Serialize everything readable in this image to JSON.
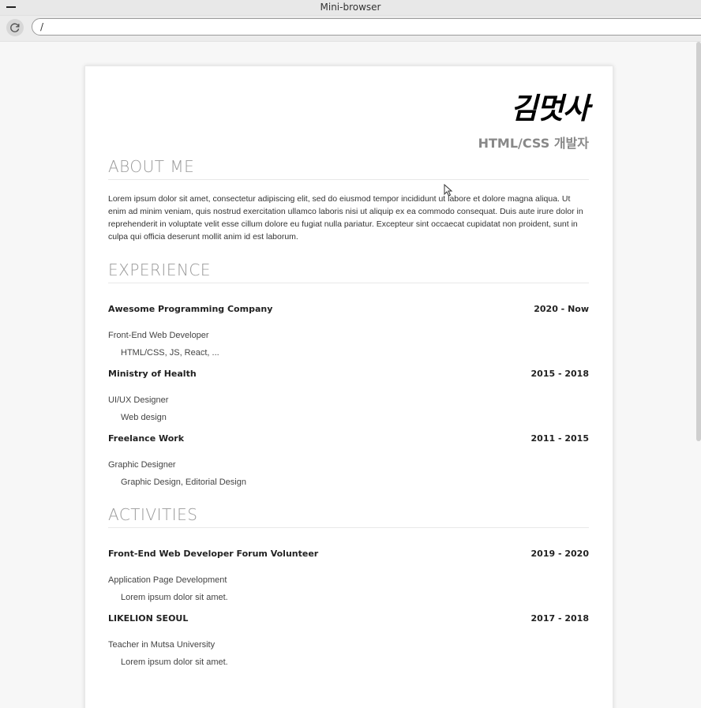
{
  "window": {
    "title": "Mini-browser"
  },
  "toolbar": {
    "address": "/"
  },
  "resume": {
    "name": "김멋사",
    "subtitle": "HTML/CSS 개발자",
    "about": {
      "title": "ABOUT ME",
      "text": "Lorem ipsum dolor sit amet, consectetur adipiscing elit, sed do eiusmod tempor incididunt ut labore et dolore magna aliqua. Ut enim ad minim veniam, quis nostrud exercitation ullamco laboris nisi ut aliquip ex ea commodo consequat. Duis aute irure dolor in reprehenderit in voluptate velit esse cillum dolore eu fugiat nulla pariatur. Excepteur sint occaecat cupidatat non proident, sunt in culpa qui officia deserunt mollit anim id est laborum."
    },
    "experience": {
      "title": "EXPERIENCE",
      "items": [
        {
          "org": "Awesome Programming Company",
          "period": "2020 - Now",
          "role": "Front-End Web Developer",
          "detail": "HTML/CSS, JS, React, ..."
        },
        {
          "org": "Ministry of Health",
          "period": "2015 - 2018",
          "role": "UI/UX Designer",
          "detail": "Web design"
        },
        {
          "org": "Freelance Work",
          "period": "2011 - 2015",
          "role": "Graphic Designer",
          "detail": "Graphic Design, Editorial Design"
        }
      ]
    },
    "activities": {
      "title": "ACTIVITIES",
      "items": [
        {
          "org": "Front-End Web Developer Forum Volunteer",
          "period": "2019 - 2020",
          "role": "Application Page Development",
          "detail": "Lorem ipsum dolor sit amet."
        },
        {
          "org": "LIKELION SEOUL",
          "period": "2017 - 2018",
          "role": "Teacher in Mutsa University",
          "detail": "Lorem ipsum dolor sit amet."
        }
      ]
    }
  }
}
